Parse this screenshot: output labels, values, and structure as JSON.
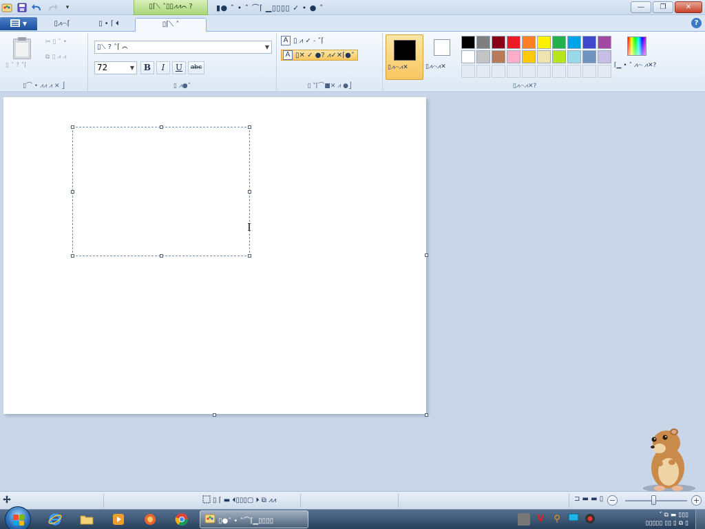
{
  "qat": {
    "save_icon": "save-icon",
    "undo_icon": "undo-icon",
    "redo_icon": "redo-icon",
    "customize_icon": "chevron-down-icon"
  },
  "context_tab_header": "▯⌈⟍ ˄▯▯⩘⩘⌒ ?",
  "window_title": "▮● ˄ • ˄ ⌒⌈ ▁▯▯▯▯ ✓ • ● ˄",
  "window_buttons": {
    "minimize": "—",
    "maximize": "❐",
    "close": "✕"
  },
  "tabs": [
    {
      "label": "▯⩘⌒⌈"
    },
    {
      "label": "▯ • ⌈ ⏴"
    },
    {
      "label": "▯⌈⟍ ˄"
    }
  ],
  "clipboard": {
    "paste_label": "▯ ˅ ? ˄⌈",
    "cut_label": "▯ ˅ •",
    "copy_label": "▯ ⩘ ⩘",
    "group_label": "▯⌒ • ⩘⩘ ⩘ ✕ ⎦"
  },
  "font": {
    "family": "▯⟍ ? ˄⌈ ⌒",
    "size": "72",
    "bold": "B",
    "italic": "I",
    "underline": "U",
    "strike": "abc",
    "group_label": "▯ ⩘●˄"
  },
  "background": {
    "opaque_label": "▯ ⩘ ✓ ˗ ˅⌈",
    "transparent_label": "▯✕ ✓ ●? ⩘✓✕⌈●˄",
    "group_label": "▯ ˅⌈⌒■✕ ⩘ ●⎦"
  },
  "colors": {
    "color1_label": "▯⩘⌒⩘✕",
    "color2_label": "▯⩘⌒⩘✕",
    "edit_label": "⌈▁ • ˄ ⩘⌒ ⩘✕?",
    "group_label": "▯⩘⌒⩘✕?",
    "color1": "#000000",
    "color2": "#ffffff",
    "swatches": [
      "#000000",
      "#7f7f7f",
      "#880015",
      "#ed1c24",
      "#ff7f27",
      "#fff200",
      "#22b14c",
      "#00a2e8",
      "#3f48cc",
      "#a349a4",
      "#ffffff",
      "#c3c3c3",
      "#b97a57",
      "#ffaec9",
      "#ffc90e",
      "#efe4b0",
      "#b5e61d",
      "#99d9ea",
      "#7092be",
      "#c8bfe7",
      "",
      "",
      "",
      "",
      "",
      "",
      "",
      "",
      "",
      ""
    ]
  },
  "status": {
    "selection_size": "▯ ⌈ ▬ ⏴▯▯▯▢ ⏵ ⧉ ⩘⩘",
    "zoom_label": "⊐ ▬ ▬ ▯",
    "zoom_out": "−",
    "zoom_in": "+"
  },
  "taskbar": {
    "task_label": "▯●˄ • ˄⌒⌈▁▯▯▯▯",
    "tray_time": "˅ ⧉ ▬ ▯▯▯",
    "tray_date": "▯▯▯▯▯ ▯▯ ▯ ⧉ ▯"
  }
}
